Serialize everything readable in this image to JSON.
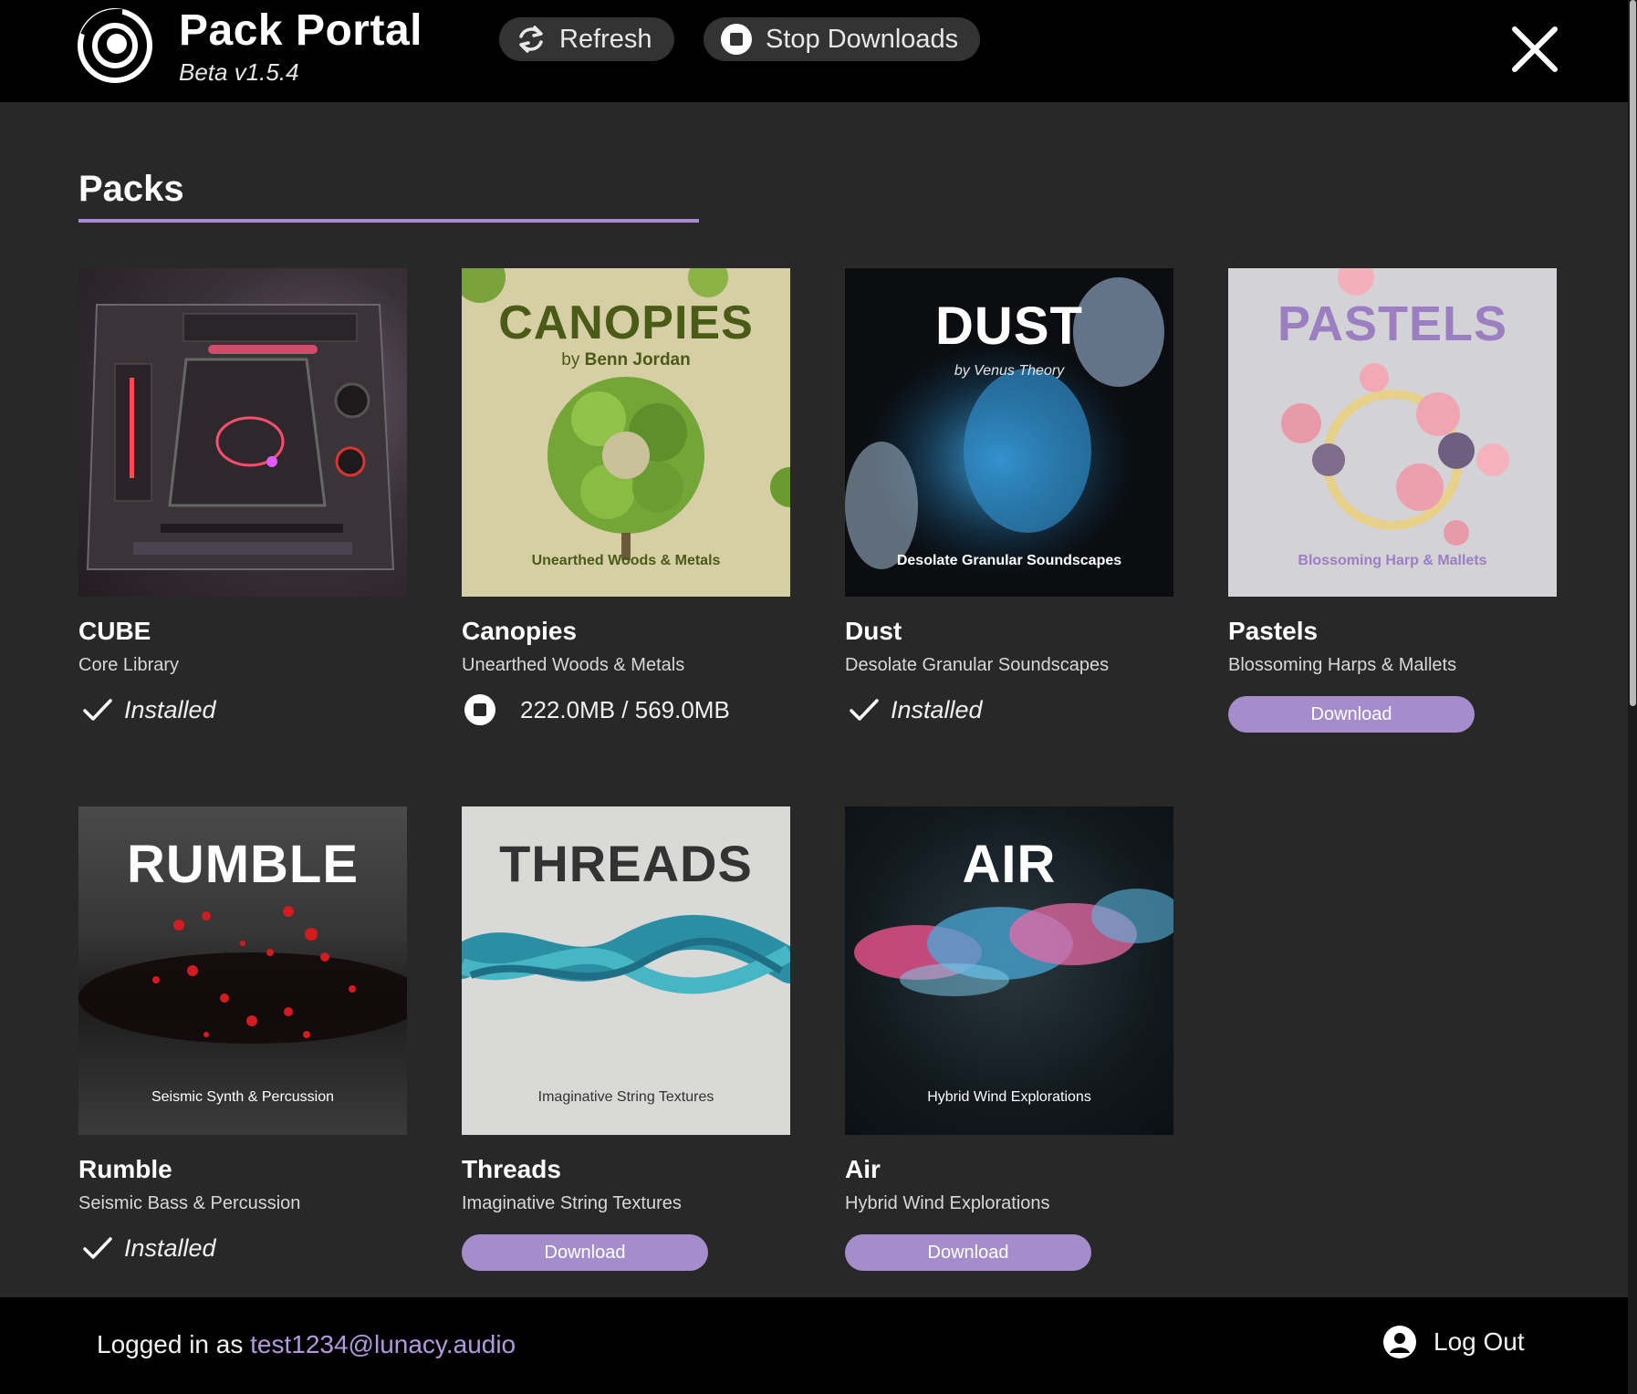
{
  "header": {
    "title": "Pack Portal",
    "version": "Beta v1.5.4",
    "refresh_label": "Refresh",
    "stop_label": "Stop Downloads"
  },
  "section": {
    "title": "Packs"
  },
  "colors": {
    "accent": "#a58dcc",
    "underline": "#a98bd0",
    "background": "#282829",
    "bar": "#000000"
  },
  "packs": [
    {
      "title": "CUBE",
      "subtitle": "Core Library",
      "status": "Installed"
    },
    {
      "title": "Canopies",
      "subtitle": "Unearthed Woods & Metals",
      "progress": "222.0MB / 569.0MB",
      "art_title": "CANOPIES",
      "art_by": "by",
      "art_author": "Benn Jordan",
      "art_tag": "Unearthed Woods & Metals"
    },
    {
      "title": "Dust",
      "subtitle": "Desolate Granular Soundscapes",
      "status": "Installed",
      "art_title": "DUST",
      "art_by": "by Venus Theory",
      "art_tag": "Desolate Granular Soundscapes"
    },
    {
      "title": "Pastels",
      "subtitle": "Blossoming Harps & Mallets",
      "button": "Download",
      "art_title": "PASTELS",
      "art_tag": "Blossoming Harp & Mallets"
    },
    {
      "title": "Rumble",
      "subtitle": "Seismic Bass & Percussion",
      "status": "Installed",
      "art_title": "RUMBLE",
      "art_tag": "Seismic Synth & Percussion"
    },
    {
      "title": "Threads",
      "subtitle": "Imaginative String Textures",
      "button": "Download",
      "art_title": "THREADS",
      "art_tag": "Imaginative String Textures"
    },
    {
      "title": "Air",
      "subtitle": "Hybrid Wind Explorations",
      "button": "Download",
      "art_title": "AIR",
      "art_tag": "Hybrid Wind Explorations"
    }
  ],
  "footer": {
    "login_prefix": "Logged in as",
    "email": "test1234@lunacy.audio",
    "logout_label": "Log Out"
  }
}
